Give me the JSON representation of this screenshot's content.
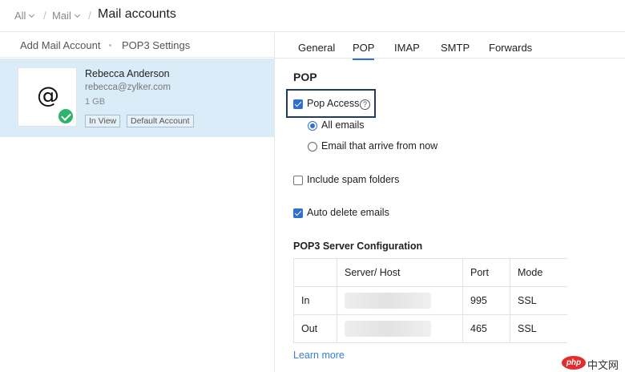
{
  "header": {
    "crumb_all": "All",
    "crumb_mail": "Mail",
    "title": "Mail accounts"
  },
  "left_panel": {
    "add_account": "Add Mail Account",
    "pop3_settings": "POP3 Settings",
    "account": {
      "name": "Rebecca Anderson",
      "email": "rebecca@zylker.com",
      "size": "1 GB",
      "tag_view": "In View",
      "tag_default": "Default Account",
      "avatar_symbol": "@"
    }
  },
  "tabs": [
    {
      "label": "General",
      "active": false
    },
    {
      "label": "POP",
      "active": true
    },
    {
      "label": "IMAP",
      "active": false
    },
    {
      "label": "SMTP",
      "active": false
    },
    {
      "label": "Forwards",
      "active": false
    }
  ],
  "pop": {
    "section_title": "POP",
    "pop_access": {
      "label": "Pop Access",
      "checked": true
    },
    "help_symbol": "?",
    "radio_all": {
      "label": "All emails",
      "selected": true
    },
    "radio_now": {
      "label": "Email that arrive from now",
      "selected": false
    },
    "include_spam": {
      "label": "Include spam folders",
      "checked": false
    },
    "auto_delete": {
      "label": "Auto delete emails",
      "checked": true
    }
  },
  "config": {
    "heading": "POP3 Server Configuration",
    "columns": [
      "",
      "Server/ Host",
      "Port",
      "Mode"
    ],
    "rows": [
      {
        "name": "In",
        "port": "995",
        "mode": "SSL"
      },
      {
        "name": "Out",
        "port": "465",
        "mode": "SSL"
      }
    ],
    "learn_more": "Learn more"
  },
  "watermark": {
    "logo": "php",
    "text": "中文网"
  },
  "colors": {
    "accent": "#2f6fd0",
    "selected_row": "#d9ecf8",
    "success": "#2fb36b",
    "highlight_border": "#1f3b63",
    "link": "#3a7bd5"
  }
}
